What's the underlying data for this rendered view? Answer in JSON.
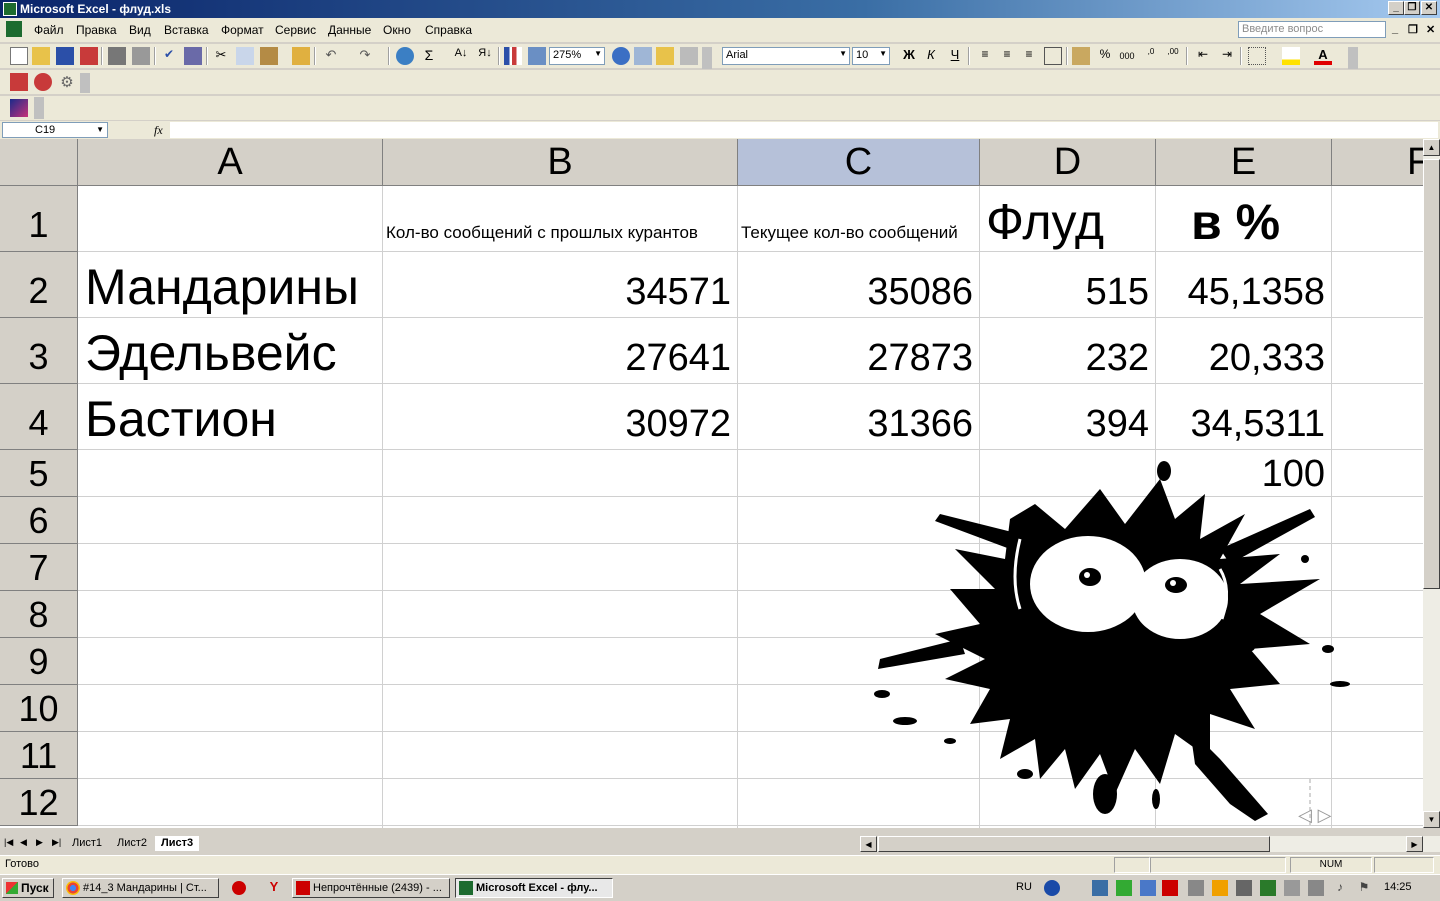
{
  "window": {
    "title": "Microsoft Excel - флуд.xls"
  },
  "menu": [
    "Файл",
    "Правка",
    "Вид",
    "Вставка",
    "Формат",
    "Сервис",
    "Данные",
    "Окно",
    "Справка"
  ],
  "help_box": {
    "placeholder": "Введите вопрос"
  },
  "toolbar": {
    "zoom": "275%",
    "font": "Arial",
    "font_size": "10"
  },
  "formula_bar": {
    "name_box": "C19",
    "fx_label": "fx",
    "formula": ""
  },
  "columns": [
    "A",
    "B",
    "C",
    "D",
    "E",
    "F"
  ],
  "rows": [
    "1",
    "2",
    "3",
    "4",
    "5",
    "6",
    "7",
    "8",
    "9",
    "10",
    "11",
    "12"
  ],
  "cells": {
    "B1": "Кол-во сообщений с прошлых курантов",
    "C1": "Текущее кол-во сообщений",
    "D1": "Флуд",
    "E1": "в %",
    "A2": "Мандарины",
    "B2": "34571",
    "C2": "35086",
    "D2": "515",
    "E2": "45,1358",
    "A3": "Эдельвейс",
    "B3": "27641",
    "C3": "27873",
    "D3": "232",
    "E3": "20,333",
    "A4": "Бастион",
    "B4": "30972",
    "C4": "31366",
    "D4": "394",
    "E4": "34,5311",
    "E5": "100"
  },
  "sheets": [
    "Лист1",
    "Лист2",
    "Лист3"
  ],
  "active_sheet": "Лист3",
  "status": {
    "text": "Готово",
    "num": "NUM"
  },
  "taskbar": {
    "start": "Пуск",
    "tasks": [
      "#14_3 Мандарины | Ст...",
      "Непрочтённые (2439) - ...",
      "Microsoft Excel - флу..."
    ],
    "lang": "RU",
    "clock": "14:25"
  },
  "colors": {
    "title_bar": "#0a246a",
    "selected_header": "#b6c1d9",
    "grid_line": "#d0d0d0"
  }
}
